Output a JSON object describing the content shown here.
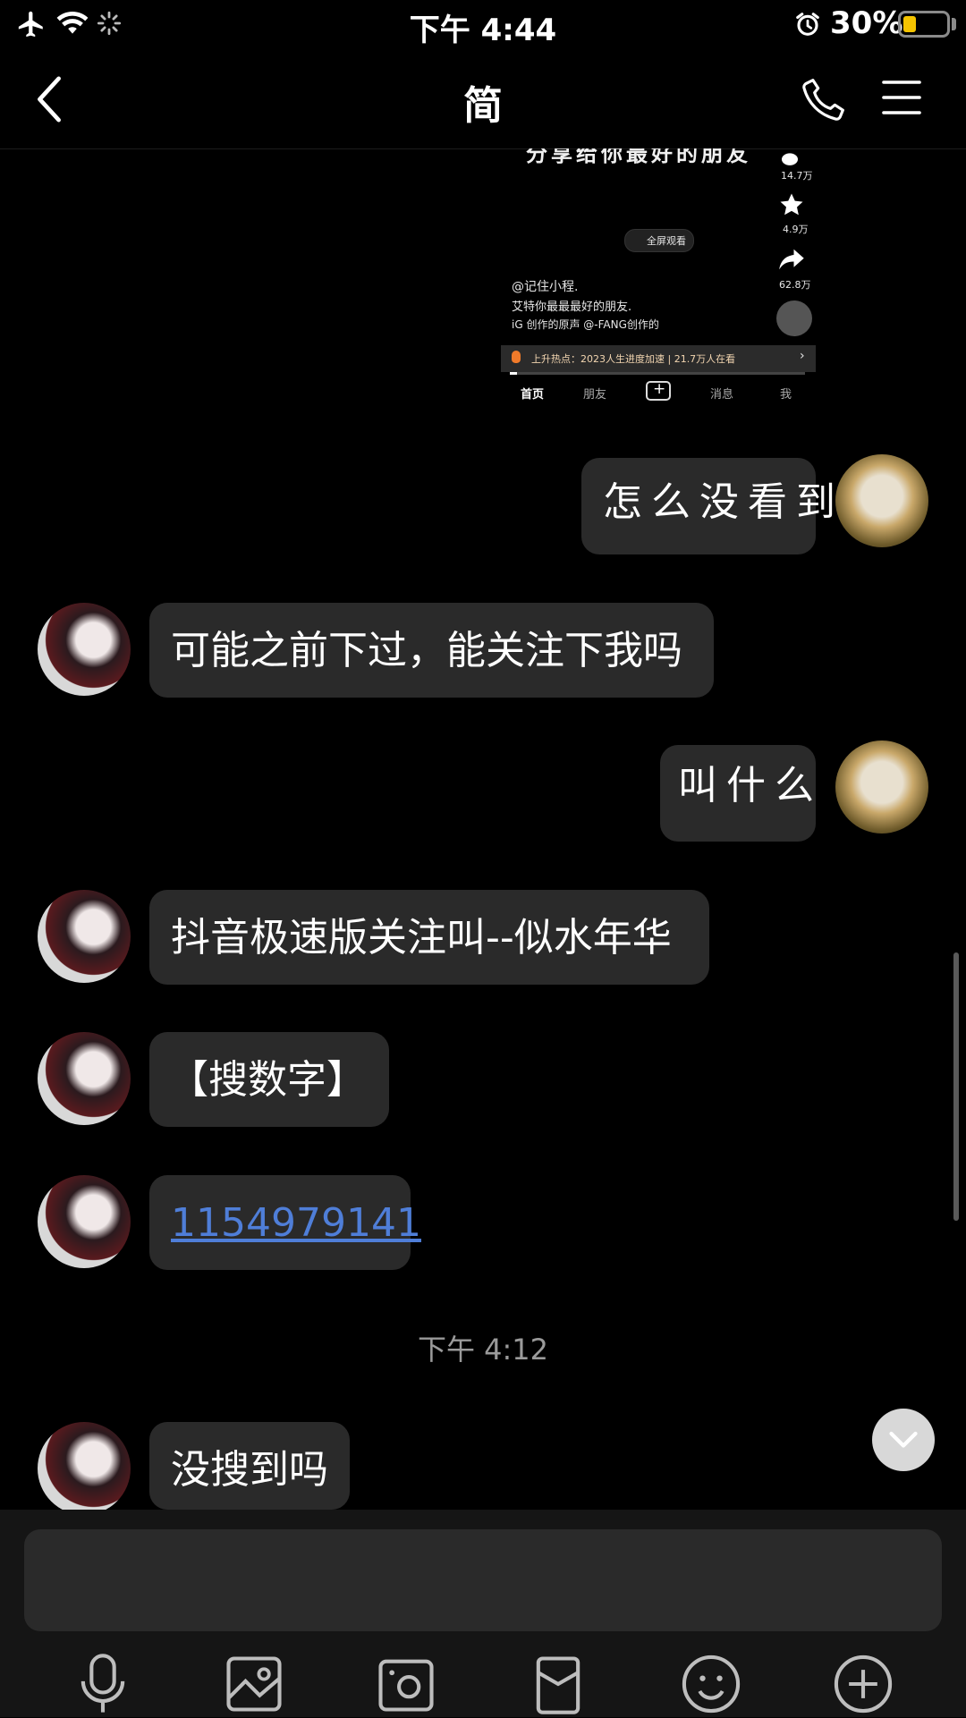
{
  "status_bar": {
    "time": "下午 4:44",
    "battery_percent": "30%",
    "battery_level": 0.3
  },
  "header": {
    "title": "简"
  },
  "shared_screenshot": {
    "partial_caption": "分享给你最好的朋友",
    "likes": "14.7万",
    "stars": "4.9万",
    "shares": "62.8万",
    "fullscreen_label": "全屏观看",
    "author": "@记住小程.",
    "description": "艾特你最最最好的朋友.",
    "music": "iG 创作的原声    @-FANG创作的",
    "hot_banner": "上升热点：2023人生进度加速 | 21.7万人在看",
    "nav": [
      "首页",
      "朋友",
      "消息",
      "我"
    ]
  },
  "messages": [
    {
      "side": "out",
      "text": "怎么没看到"
    },
    {
      "side": "in",
      "text": "可能之前下过，能关注下我吗"
    },
    {
      "side": "out",
      "text": "叫什么"
    },
    {
      "side": "in",
      "text": "抖音极速版关注叫--似水年华"
    },
    {
      "side": "in",
      "text": "【搜数字】"
    },
    {
      "side": "in",
      "text": "1154979141",
      "link": true
    },
    {
      "timestamp": "下午 4:12"
    },
    {
      "side": "in",
      "text": "没搜到吗"
    }
  ],
  "toolbar_icons": [
    "microphone-icon",
    "image-icon",
    "camera-icon",
    "red-packet-icon",
    "emoji-icon",
    "plus-icon"
  ],
  "colors": {
    "background": "#000000",
    "bubble": "#2a2a2a",
    "link": "#4f7ed8",
    "battery": "#f5c400"
  }
}
